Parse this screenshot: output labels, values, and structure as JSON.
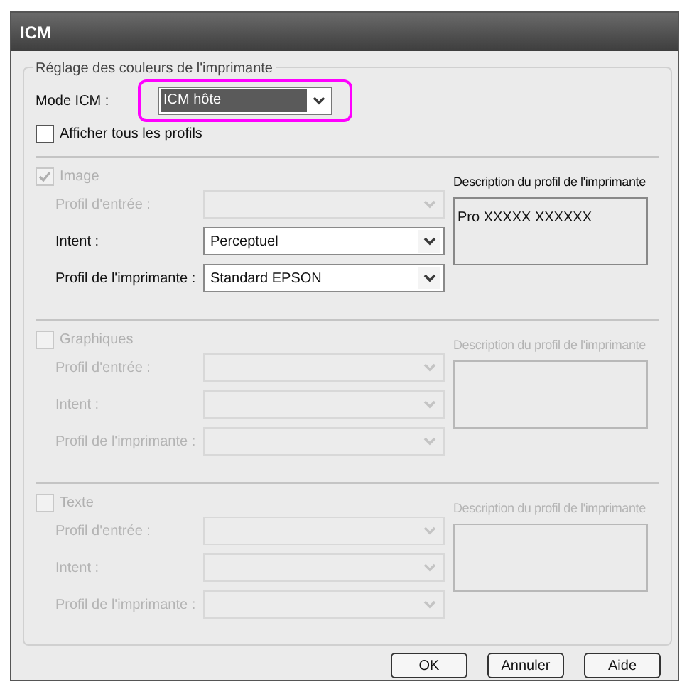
{
  "window": {
    "title": "ICM"
  },
  "group": {
    "title": "Réglage des couleurs de l'imprimante"
  },
  "mode": {
    "label": "Mode ICM :",
    "value": "ICM hôte",
    "highlighted": true
  },
  "show_all": {
    "label": "Afficher tous les profils",
    "checked": false
  },
  "sections": [
    {
      "label": "Image",
      "checked": true,
      "disabled": true,
      "rows": [
        {
          "label": "Profil d'entrée :",
          "disabled": true
        },
        {
          "label": "Intent :",
          "value": "Perceptuel",
          "disabled": false
        },
        {
          "label": "Profil de l'imprimante :",
          "value": "Standard EPSON",
          "disabled": false
        }
      ],
      "description": {
        "label": "Description du profil de l'imprimante",
        "text": "Pro XXXXX XXXXXX",
        "disabled": false
      }
    },
    {
      "label": "Graphiques",
      "checked": false,
      "disabled": true,
      "rows": [
        {
          "label": "Profil d'entrée :",
          "disabled": true
        },
        {
          "label": "Intent :",
          "disabled": true
        },
        {
          "label": "Profil de l'imprimante :",
          "disabled": true
        }
      ],
      "description": {
        "label": "Description du profil de l'imprimante",
        "disabled": true
      }
    },
    {
      "label": "Texte",
      "checked": false,
      "disabled": true,
      "rows": [
        {
          "label": "Profil d'entrée :",
          "disabled": true
        },
        {
          "label": "Intent :",
          "disabled": true
        },
        {
          "label": "Profil de l'imprimante :",
          "disabled": true
        }
      ],
      "description": {
        "label": "Description du profil de l'imprimante",
        "disabled": true
      }
    }
  ],
  "buttons": [
    "OK",
    "Annuler",
    "Aide"
  ]
}
